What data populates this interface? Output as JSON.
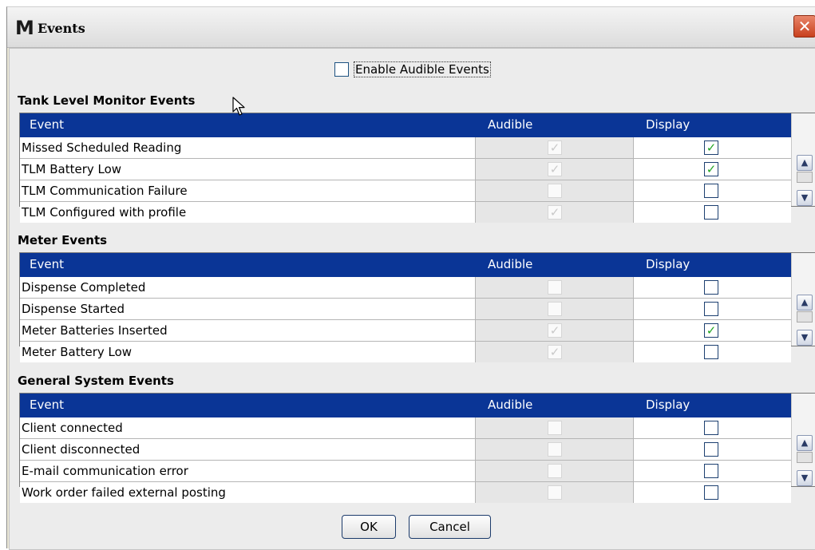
{
  "window": {
    "logo": "M",
    "title": "Events",
    "close_label": "✕"
  },
  "enable_audible": {
    "label": "Enable Audible Events",
    "checked": false
  },
  "columns": {
    "event": "Event",
    "audible": "Audible",
    "display": "Display"
  },
  "sections": [
    {
      "title": "Tank Level Monitor Events",
      "rows": [
        {
          "event": "Missed Scheduled Reading",
          "audible": "✓",
          "display": "✓"
        },
        {
          "event": "TLM Battery Low",
          "audible": "✓",
          "display": "✓"
        },
        {
          "event": "TLM Communication Failure",
          "audible": "",
          "display": ""
        },
        {
          "event": "TLM Configured with profile",
          "audible": "✓",
          "display": ""
        }
      ]
    },
    {
      "title": "Meter Events",
      "rows": [
        {
          "event": "Dispense Completed",
          "audible": "",
          "display": ""
        },
        {
          "event": "Dispense Started",
          "audible": "",
          "display": ""
        },
        {
          "event": "Meter Batteries Inserted",
          "audible": "✓",
          "display": "✓"
        },
        {
          "event": "Meter Battery Low",
          "audible": "✓",
          "display": ""
        }
      ]
    },
    {
      "title": "General System Events",
      "rows": [
        {
          "event": "Client connected",
          "audible": "",
          "display": ""
        },
        {
          "event": "Client disconnected",
          "audible": "",
          "display": ""
        },
        {
          "event": "E-mail communication error",
          "audible": "",
          "display": ""
        },
        {
          "event": "Work order failed external posting",
          "audible": "",
          "display": ""
        }
      ]
    }
  ],
  "scroll": {
    "up": "▲",
    "down": "▼"
  },
  "buttons": {
    "ok": "OK",
    "cancel": "Cancel"
  }
}
